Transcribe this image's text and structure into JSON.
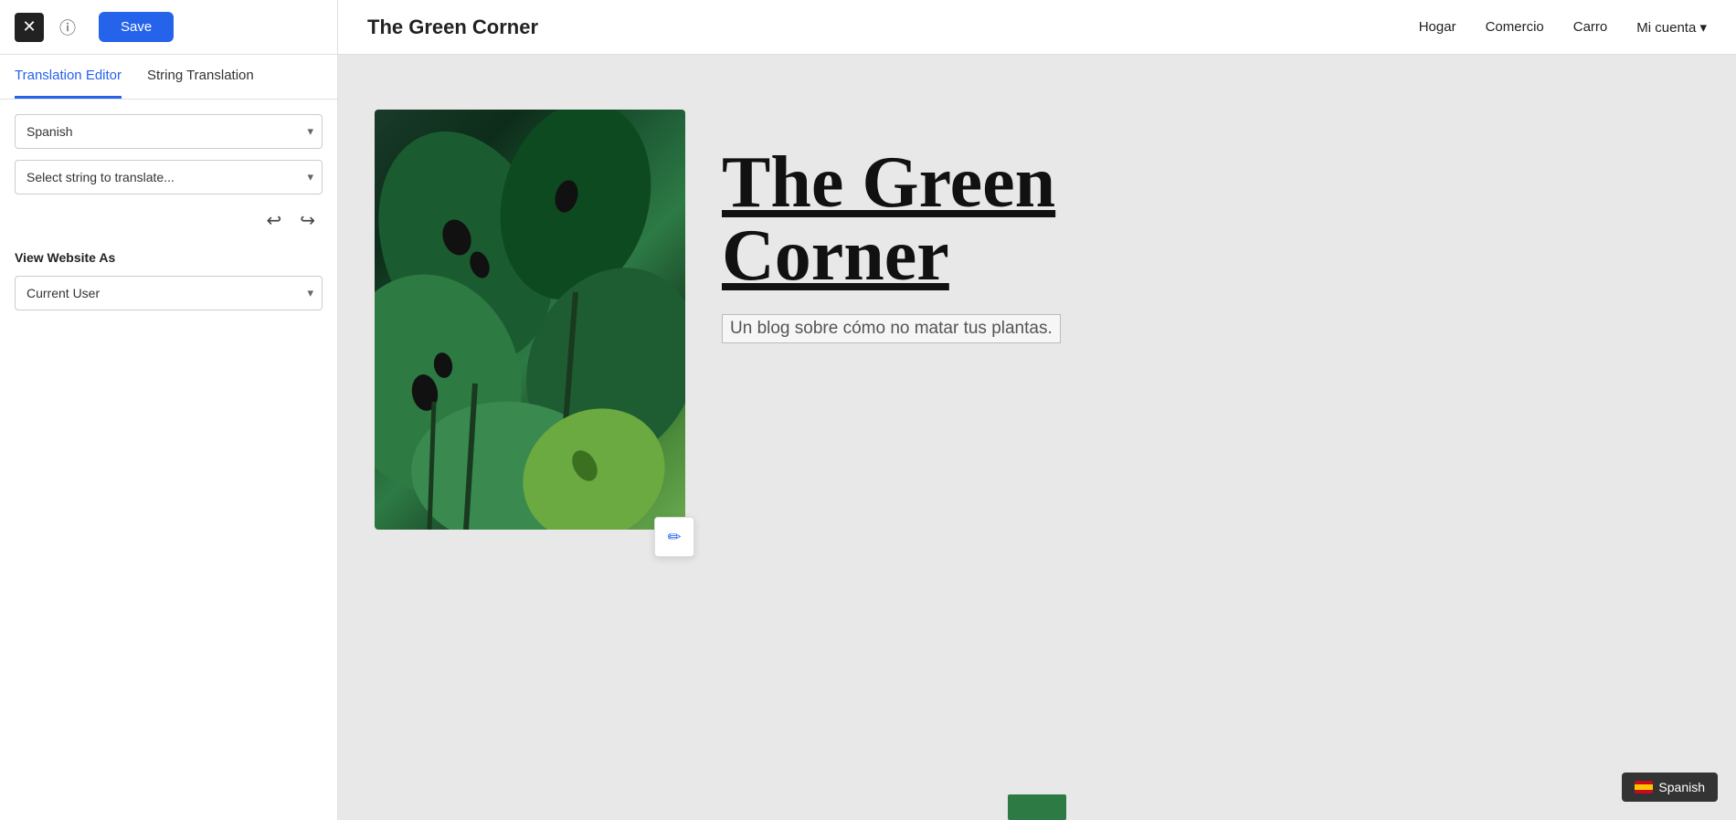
{
  "topBar": {
    "saveLabel": "Save"
  },
  "tabs": {
    "tab1": "Translation Editor",
    "tab2": "String Translation",
    "activeTab": "tab1"
  },
  "sidebar": {
    "languageLabel": "Spanish",
    "languagePlaceholder": "Spanish",
    "selectStringPlaceholder": "Select string to translate...",
    "viewWebsiteAsLabel": "View Website As",
    "currentUserLabel": "Current User"
  },
  "siteHeader": {
    "title": "The Green Corner",
    "nav": [
      {
        "label": "Hogar"
      },
      {
        "label": "Comercio"
      },
      {
        "label": "Carro"
      },
      {
        "label": "Mi cuenta ▾"
      }
    ]
  },
  "mainContent": {
    "heroTitle": "The Green Corner",
    "heroSubtitle": "Un blog sobre cómo no matar tus plantas."
  },
  "spanishBadge": {
    "label": "Spanish"
  },
  "icons": {
    "close": "✕",
    "info": "ⓘ",
    "undo": "↩",
    "redo": "↪",
    "chevronDown": "▾",
    "pencil": "✏"
  }
}
